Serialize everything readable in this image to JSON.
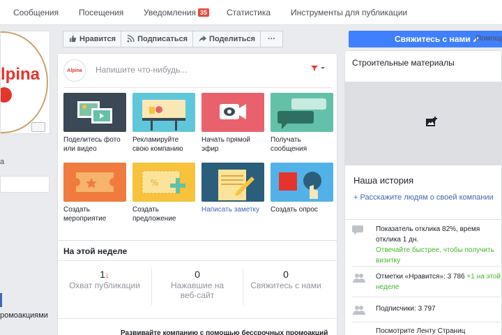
{
  "topnav": {
    "items": [
      "Сообщения",
      "Посещения",
      "Уведомления",
      "Статистика",
      "Инструменты для публикации"
    ],
    "notifications_badge": "35"
  },
  "left": {
    "avatar_text": "lpina",
    "letter": "а",
    "promo_label": "ромоакциями"
  },
  "actions": {
    "like": "Нравится",
    "subscribe": "Подписаться",
    "share": "Поделиться",
    "more": "···"
  },
  "composer": {
    "avatar_text": "Alpina",
    "placeholder": "Напишите что-нибудь...",
    "tiles": [
      {
        "label": "Поделитесь фото или видео",
        "color": "#3b4856"
      },
      {
        "label": "Рекламируйте свою компанию",
        "color": "#5fc7d9"
      },
      {
        "label": "Начать прямой эфир",
        "color": "#e9616c"
      },
      {
        "label": "Получать сообщения",
        "color": "#62c1a8"
      },
      {
        "label": "Создать мероприятие",
        "color": "#f07b3f"
      },
      {
        "label": "Создать предложение",
        "color": "#f7c23c"
      },
      {
        "label": "Написать заметку",
        "color": "#2b5e7a",
        "link": true
      },
      {
        "label": "Создать опрос",
        "color": "#52b2e8"
      }
    ]
  },
  "week": {
    "title": "На этой неделе",
    "stats": [
      {
        "value": "1",
        "caption": "Охват публикации",
        "arrow": "↓"
      },
      {
        "value": "0",
        "caption": "Нажавшие на веб-сайт"
      },
      {
        "value": "0",
        "caption": "Свяжитесь с нами"
      }
    ],
    "promo": "Развивайте компанию с помощью бессрочных промоакций"
  },
  "right": {
    "contact_button": "Свяжитесь с нами",
    "contact_faint": "Мне нравится",
    "help": "Помощь",
    "category": "Строительные материалы",
    "story_title": "Наша история",
    "story_link": "+ Расскажите людям о своей компании",
    "stats": {
      "response": "Показатель отклика 82%, время отклика 1 дн.",
      "response_hint": "Отвечайте быстрее, чтобы получить визитку",
      "likes_prefix": "Отметки «Нравится»: 3 786",
      "likes_growth": "+1 на этой неделе",
      "followers": "Подписчики: 3 797",
      "feed": "Посмотрите Ленту Страниц"
    }
  }
}
